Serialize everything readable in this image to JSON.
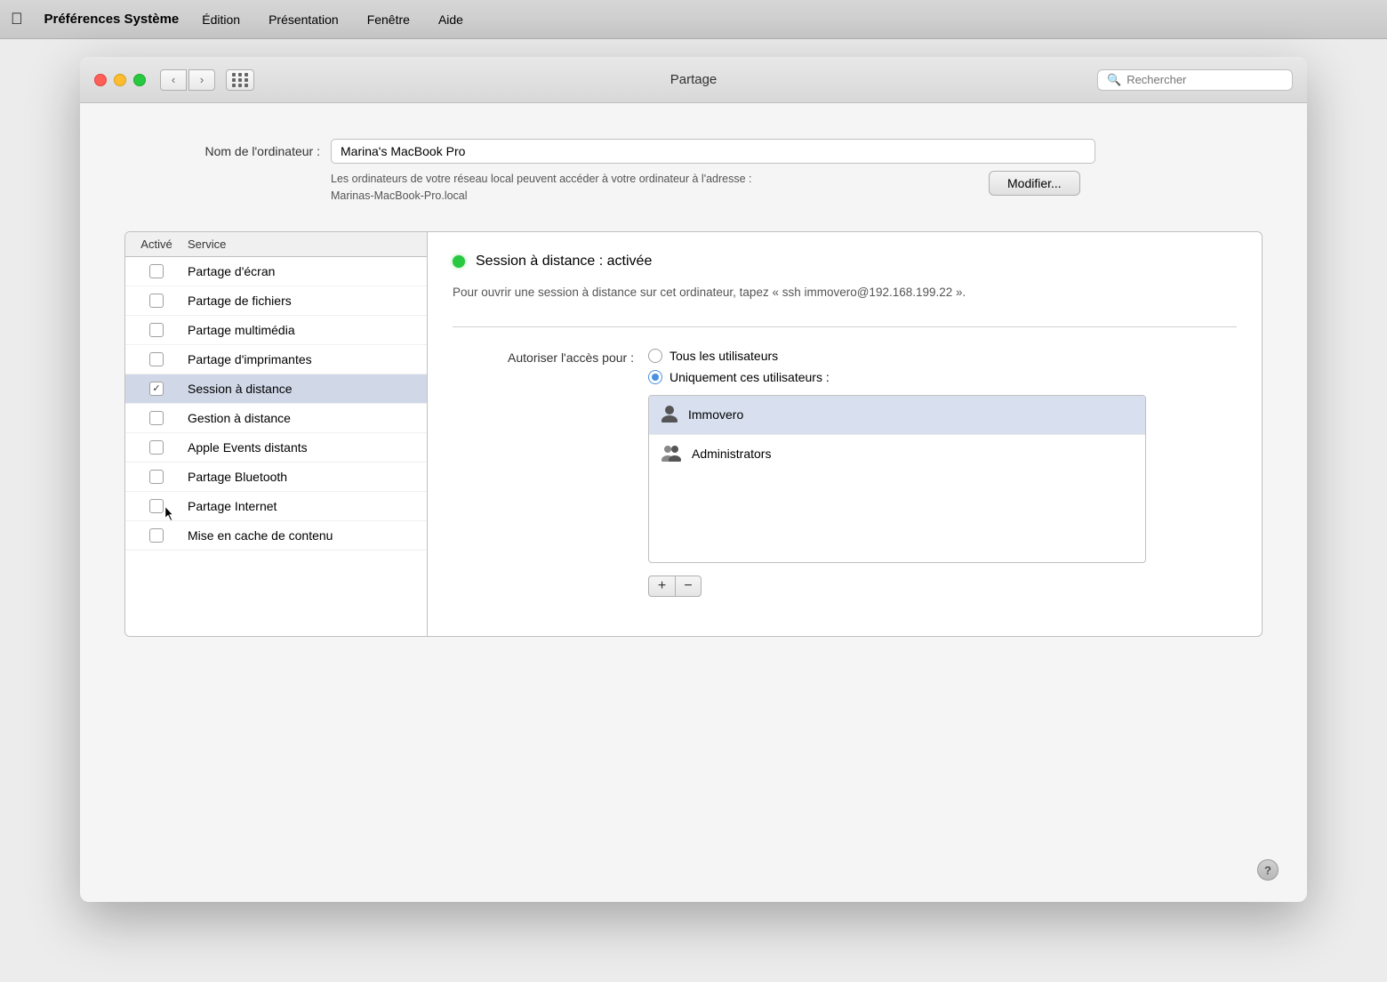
{
  "menubar": {
    "apple_label": "",
    "app_name": "Préférences Système",
    "items": [
      "Édition",
      "Présentation",
      "Fenêtre",
      "Aide"
    ]
  },
  "titlebar": {
    "title": "Partage",
    "search_placeholder": "Rechercher"
  },
  "computer_name": {
    "label": "Nom de l'ordinateur :",
    "value": "Marina's MacBook Pro",
    "address_text_line1": "Les ordinateurs de votre réseau local peuvent accéder à votre ordinateur à l'adresse :",
    "address_text_line2": "Marinas-MacBook-Pro.local",
    "modify_button": "Modifier..."
  },
  "service_list": {
    "col_active": "Activé",
    "col_service": "Service",
    "services": [
      {
        "id": "partage-ecran",
        "name": "Partage d'écran",
        "checked": false,
        "selected": false
      },
      {
        "id": "partage-fichiers",
        "name": "Partage de fichiers",
        "checked": false,
        "selected": false
      },
      {
        "id": "partage-multimedia",
        "name": "Partage multimédia",
        "checked": false,
        "selected": false
      },
      {
        "id": "partage-imprimantes",
        "name": "Partage d'imprimantes",
        "checked": false,
        "selected": false
      },
      {
        "id": "session-distance",
        "name": "Session à distance",
        "checked": true,
        "selected": true
      },
      {
        "id": "gestion-distance",
        "name": "Gestion à distance",
        "checked": false,
        "selected": false
      },
      {
        "id": "apple-events",
        "name": "Apple Events distants",
        "checked": false,
        "selected": false
      },
      {
        "id": "partage-bluetooth",
        "name": "Partage Bluetooth",
        "checked": false,
        "selected": false
      },
      {
        "id": "partage-internet",
        "name": "Partage Internet",
        "checked": false,
        "selected": false
      },
      {
        "id": "mise-en-cache",
        "name": "Mise en cache de contenu",
        "checked": false,
        "selected": false
      }
    ]
  },
  "detail": {
    "status_label": "Session à distance : activée",
    "status_active": true,
    "description": "Pour ouvrir une session à distance sur cet ordinateur, tapez « ssh immovero@192.168.199.22 ».",
    "access_label": "Autoriser l'accès pour :",
    "access_options": [
      {
        "id": "tous",
        "label": "Tous les utilisateurs",
        "selected": false
      },
      {
        "id": "uniquement",
        "label": "Uniquement ces utilisateurs :",
        "selected": true
      }
    ],
    "users": [
      {
        "id": "immovero",
        "name": "Immovero",
        "icon": "👤",
        "selected": true
      },
      {
        "id": "administrators",
        "name": "Administrators",
        "icon": "👥",
        "selected": false
      }
    ],
    "add_button": "+",
    "remove_button": "−"
  },
  "help_button": "?"
}
